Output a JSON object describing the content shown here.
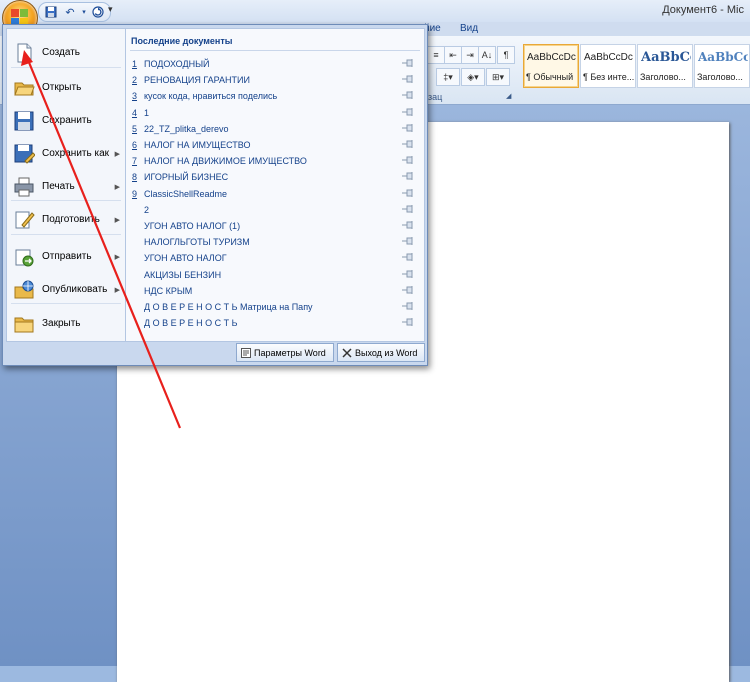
{
  "window": {
    "title": "Документ6 - Mic"
  },
  "ribbon": {
    "tabs_visible": [
      "йие",
      "Вид"
    ],
    "group_fragment": "зац",
    "styles": [
      {
        "sample": "AaBbCcDc",
        "name": "¶ Обычный"
      },
      {
        "sample": "AaBbCcDc",
        "name": "¶ Без инте..."
      },
      {
        "sample": "AaBbCc",
        "name": "Заголово..."
      },
      {
        "sample": "AaBbCc",
        "name": "Заголово..."
      }
    ]
  },
  "menu": {
    "commands": [
      {
        "label": "Создать",
        "icon": "new-document-icon",
        "submenu": false
      },
      {
        "label": "Открыть",
        "icon": "open-folder-icon",
        "submenu": false
      },
      {
        "label": "Сохранить",
        "icon": "save-disk-icon",
        "submenu": false
      },
      {
        "label": "Сохранить как",
        "icon": "save-as-icon",
        "submenu": true
      },
      {
        "label": "Печать",
        "icon": "printer-icon",
        "submenu": true
      },
      {
        "label": "Подготовить",
        "icon": "prepare-icon",
        "submenu": true
      },
      {
        "label": "Отправить",
        "icon": "send-icon",
        "submenu": true
      },
      {
        "label": "Опубликовать",
        "icon": "publish-icon",
        "submenu": true
      },
      {
        "label": "Закрыть",
        "icon": "close-folder-icon",
        "submenu": false
      }
    ],
    "recent_header": "Последние документы",
    "recent": [
      {
        "num": "1",
        "name": "ПОДОХОДНЫЙ"
      },
      {
        "num": "2",
        "name": "РЕНОВАЦИЯ ГАРАНТИИ"
      },
      {
        "num": "3",
        "name": "кусок кода, нравиться поделись"
      },
      {
        "num": "4",
        "name": "1"
      },
      {
        "num": "5",
        "name": "22_TZ_plitka_derevo"
      },
      {
        "num": "6",
        "name": "НАЛОГ НА ИМУЩЕСТВО"
      },
      {
        "num": "7",
        "name": "НАЛОГ НА ДВИЖИМОЕ ИМУЩЕСТВО"
      },
      {
        "num": "8",
        "name": "ИГОРНЫЙ БИЗНЕС"
      },
      {
        "num": "9",
        "name": "ClassicShellReadme"
      },
      {
        "num": "",
        "name": "2"
      },
      {
        "num": "",
        "name": "УГОН АВТО НАЛОГ (1)"
      },
      {
        "num": "",
        "name": "НАЛОГЛЬГОТЫ ТУРИЗМ"
      },
      {
        "num": "",
        "name": "УГОН АВТО НАЛОГ"
      },
      {
        "num": "",
        "name": "АКЦИЗЫ БЕНЗИН"
      },
      {
        "num": "",
        "name": "НДС КРЫМ"
      },
      {
        "num": "",
        "name": "Д О В Е Р Е Н О С Т Ь Матрица на Папу"
      },
      {
        "num": "",
        "name": "Д О В Е Р Е Н О С Т Ь"
      }
    ],
    "options_button": "Параметры Word",
    "exit_button": "Выход из Word"
  },
  "annotation": {
    "arrow_color": "#e8201c"
  }
}
